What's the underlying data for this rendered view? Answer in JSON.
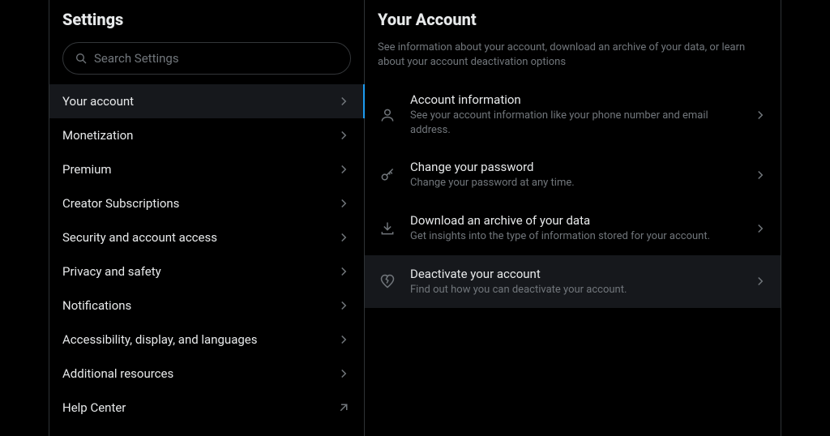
{
  "settings": {
    "title": "Settings",
    "search_placeholder": "Search Settings",
    "nav": [
      {
        "label": "Your account",
        "active": true,
        "external": false
      },
      {
        "label": "Monetization",
        "active": false,
        "external": false
      },
      {
        "label": "Premium",
        "active": false,
        "external": false
      },
      {
        "label": "Creator Subscriptions",
        "active": false,
        "external": false
      },
      {
        "label": "Security and account access",
        "active": false,
        "external": false
      },
      {
        "label": "Privacy and safety",
        "active": false,
        "external": false
      },
      {
        "label": "Notifications",
        "active": false,
        "external": false
      },
      {
        "label": "Accessibility, display, and languages",
        "active": false,
        "external": false
      },
      {
        "label": "Additional resources",
        "active": false,
        "external": false
      },
      {
        "label": "Help Center",
        "active": false,
        "external": true
      }
    ]
  },
  "detail": {
    "title": "Your Account",
    "subtitle": "See information about your account, download an archive of your data, or learn about your account deactivation options",
    "options": [
      {
        "icon": "user",
        "title": "Account information",
        "desc": "See your account information like your phone number and email address.",
        "highlight": false
      },
      {
        "icon": "key",
        "title": "Change your password",
        "desc": "Change your password at any time.",
        "highlight": false
      },
      {
        "icon": "download",
        "title": "Download an archive of your data",
        "desc": "Get insights into the type of information stored for your account.",
        "highlight": false
      },
      {
        "icon": "heart-broken",
        "title": "Deactivate your account",
        "desc": "Find out how you can deactivate your account.",
        "highlight": true
      }
    ]
  }
}
